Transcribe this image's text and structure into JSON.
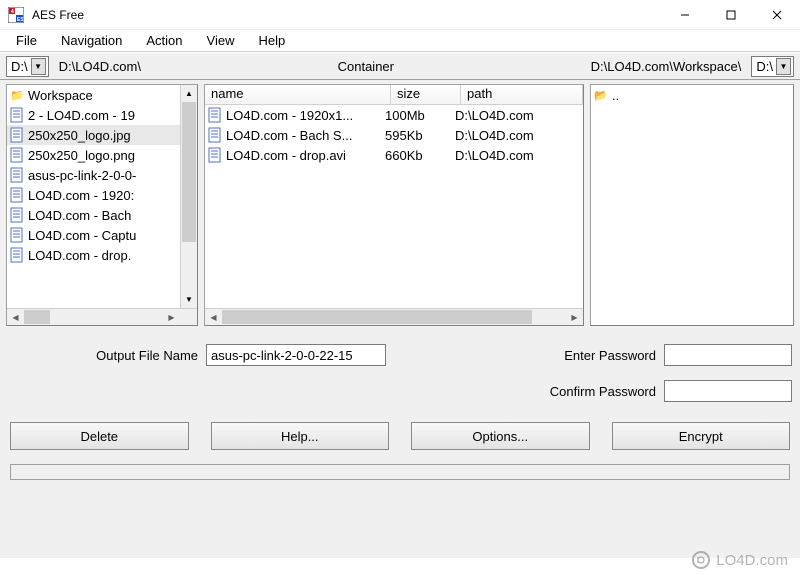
{
  "window": {
    "title": "AES Free"
  },
  "menu": {
    "items": [
      "File",
      "Navigation",
      "Action",
      "View",
      "Help"
    ]
  },
  "pathbar": {
    "left_drive": "D:\\",
    "left_path": "D:\\LO4D.com\\",
    "center_label": "Container",
    "right_path": "D:\\LO4D.com\\Workspace\\",
    "right_drive": "D:\\"
  },
  "left_panel": {
    "items": [
      {
        "type": "folder",
        "name": "Workspace"
      },
      {
        "type": "file",
        "name": "2 - LO4D.com - 19"
      },
      {
        "type": "file",
        "name": "250x250_logo.jpg"
      },
      {
        "type": "file",
        "name": "250x250_logo.png"
      },
      {
        "type": "file",
        "name": "asus-pc-link-2-0-0-"
      },
      {
        "type": "file",
        "name": "LO4D.com - 1920:"
      },
      {
        "type": "file",
        "name": "LO4D.com - Bach"
      },
      {
        "type": "file",
        "name": "LO4D.com - Captu"
      },
      {
        "type": "file",
        "name": "LO4D.com - drop."
      }
    ]
  },
  "mid_panel": {
    "headers": {
      "name": "name",
      "size": "size",
      "path": "path"
    },
    "rows": [
      {
        "name": "LO4D.com - 1920x1...",
        "size": "100Mb",
        "path": "D:\\LO4D.com"
      },
      {
        "name": "LO4D.com - Bach S...",
        "size": "595Kb",
        "path": "D:\\LO4D.com"
      },
      {
        "name": "LO4D.com - drop.avi",
        "size": "660Kb",
        "path": "D:\\LO4D.com"
      }
    ]
  },
  "right_panel": {
    "up_label": ".."
  },
  "form": {
    "output_label": "Output File Name",
    "output_value": "asus-pc-link-2-0-0-22-15",
    "enter_pw_label": "Enter Password",
    "confirm_pw_label": "Confirm Password"
  },
  "buttons": {
    "delete": "Delete",
    "help": "Help...",
    "options": "Options...",
    "encrypt": "Encrypt"
  },
  "watermark": "LO4D.com"
}
